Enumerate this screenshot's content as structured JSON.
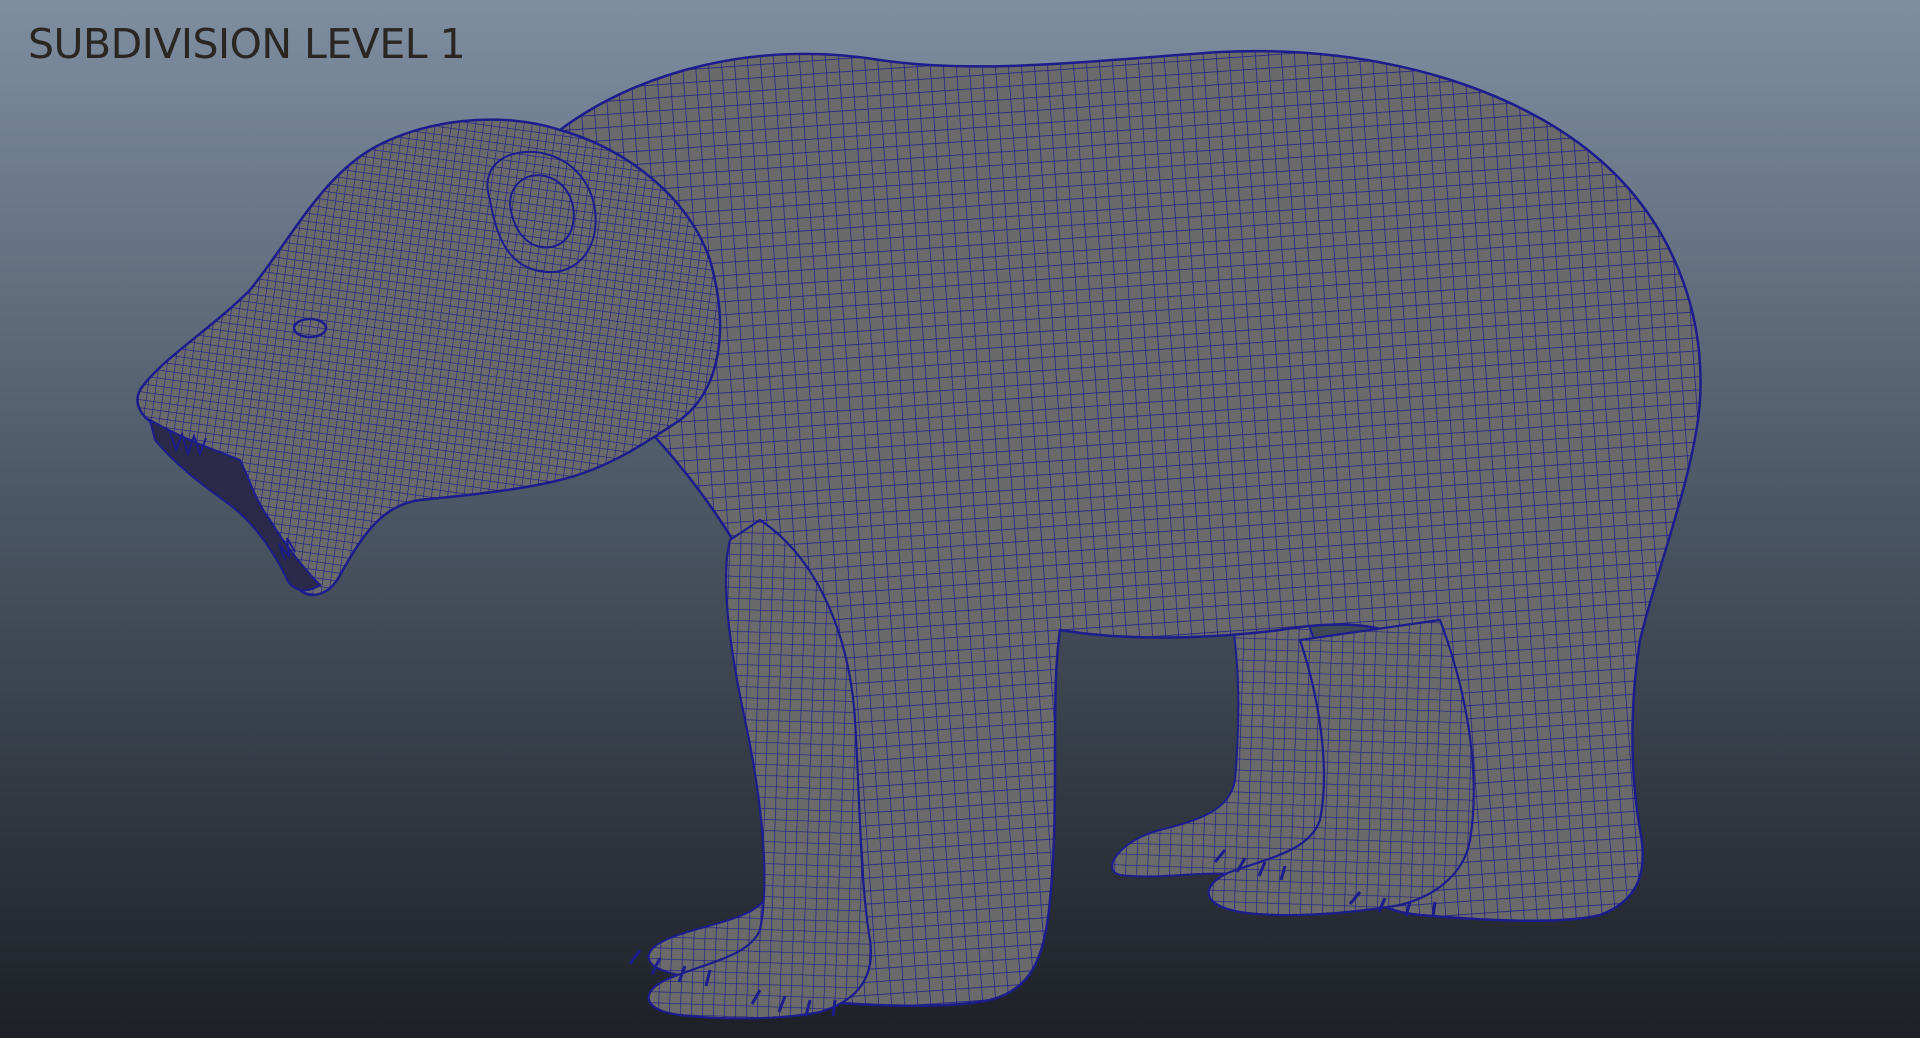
{
  "viewport": {
    "label": "SUBDIVISION LEVEL 1",
    "colors": {
      "background_top": "#7e8ea1",
      "background_mid": "#4a5563",
      "background_bottom": "#1d2026",
      "mesh_fill": "#6a6a6a",
      "wire_color": "#1c1c8c"
    }
  },
  "model": {
    "subject": "bear",
    "display": "wireframe-on-shaded"
  }
}
